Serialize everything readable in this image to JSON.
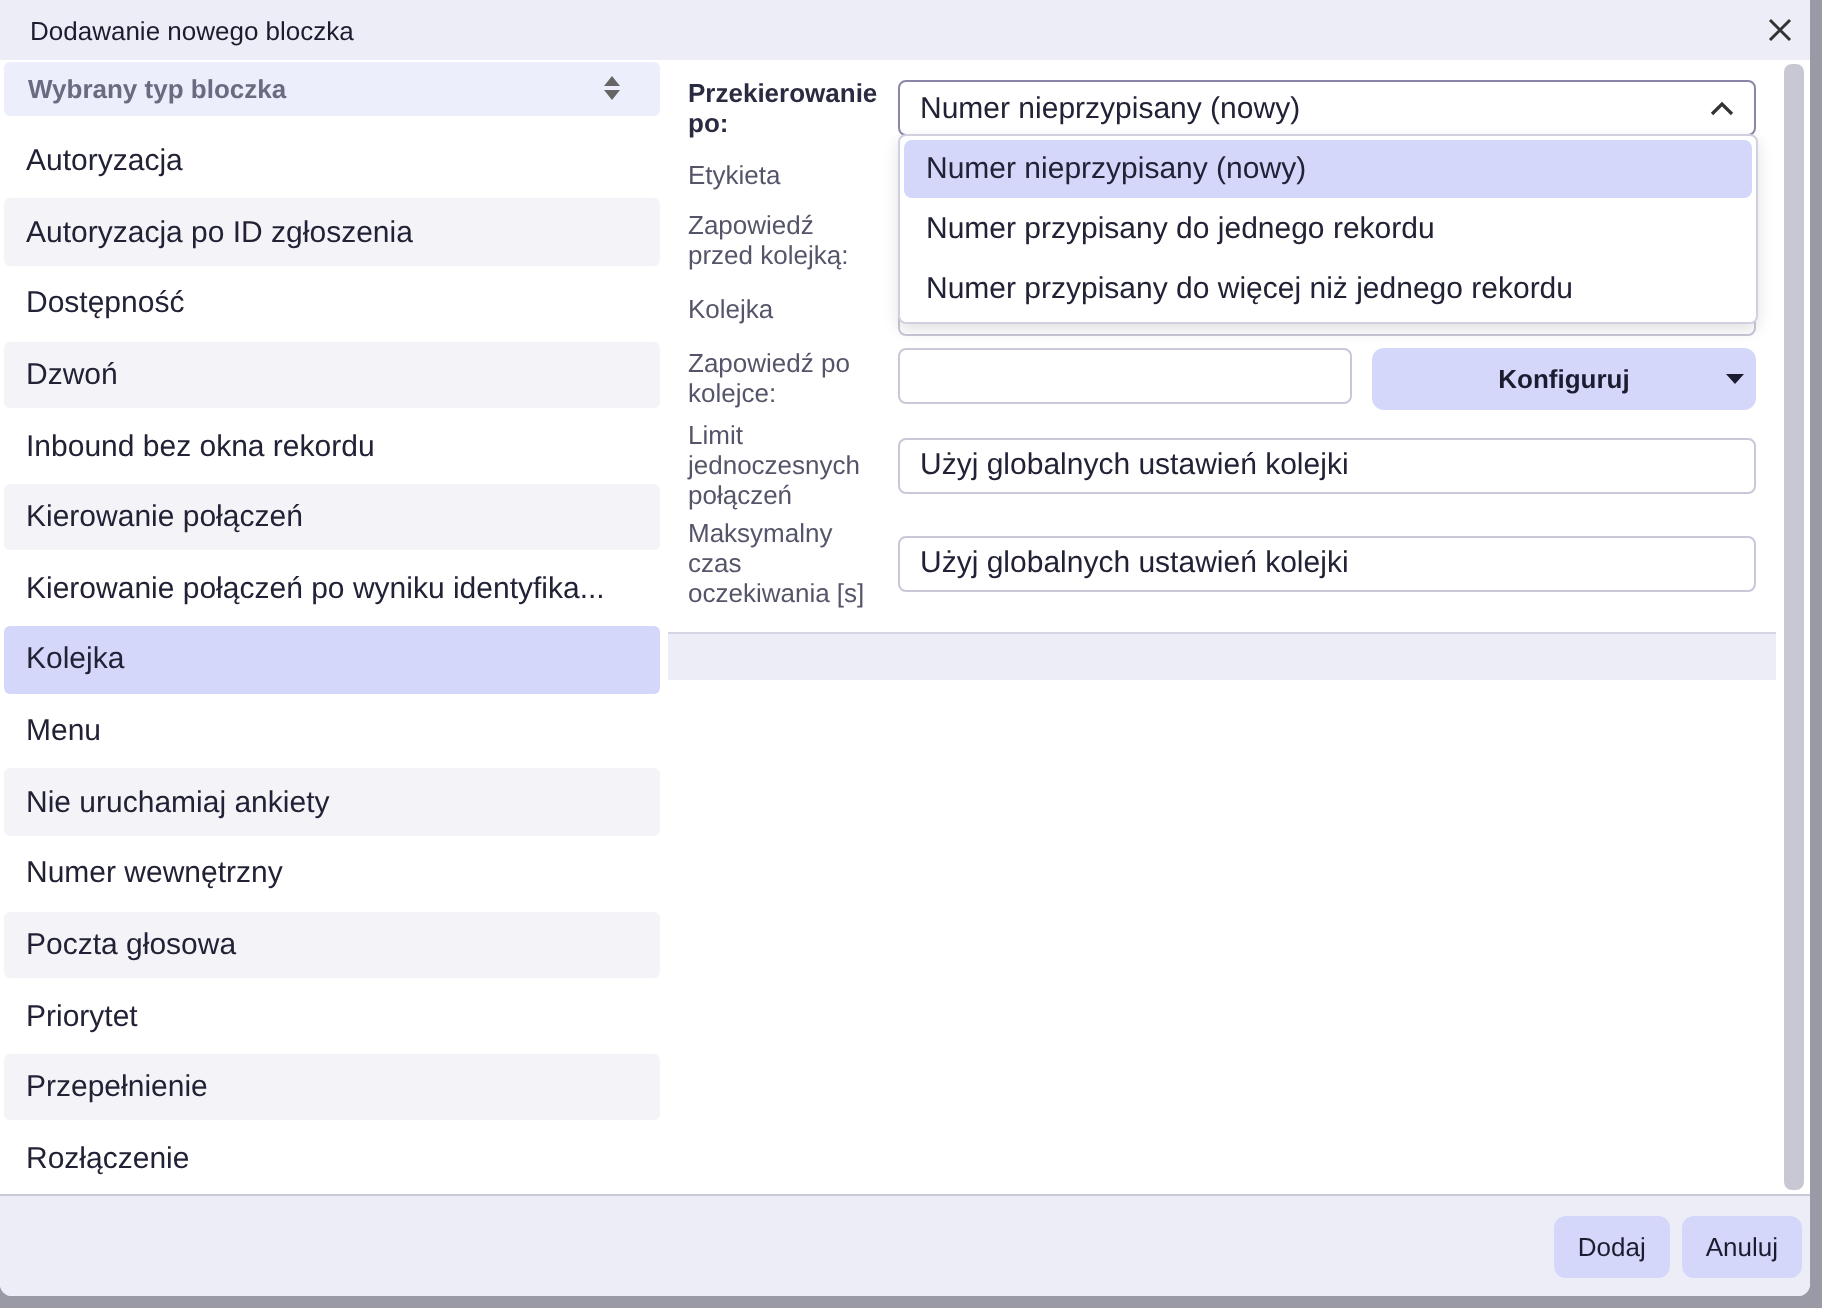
{
  "window": {
    "title": "Dodawanie nowego bloczka"
  },
  "sidebar": {
    "header": "Wybrany typ bloczka",
    "items": [
      {
        "label": "Autoryzacja",
        "selected": false
      },
      {
        "label": "Autoryzacja po ID zgłoszenia",
        "selected": false
      },
      {
        "label": "Dostępność",
        "selected": false
      },
      {
        "label": "Dzwoń",
        "selected": false
      },
      {
        "label": "Inbound bez okna rekordu",
        "selected": false
      },
      {
        "label": "Kierowanie połączeń",
        "selected": false
      },
      {
        "label": "Kierowanie połączeń po wyniku identyfika...",
        "selected": false
      },
      {
        "label": "Kolejka",
        "selected": true
      },
      {
        "label": "Menu",
        "selected": false
      },
      {
        "label": "Nie uruchamiaj ankiety",
        "selected": false
      },
      {
        "label": "Numer wewnętrzny",
        "selected": false
      },
      {
        "label": "Poczta głosowa",
        "selected": false
      },
      {
        "label": "Priorytet",
        "selected": false
      },
      {
        "label": "Przepełnienie",
        "selected": false
      },
      {
        "label": "Rozłączenie",
        "selected": false
      }
    ]
  },
  "form": {
    "fields": [
      {
        "label": "Przekierowanie po:",
        "kind": "select",
        "value": "Numer nieprzypisany (nowy)",
        "expanded": true,
        "options": [
          {
            "label": "Numer nieprzypisany (nowy)",
            "selected": true
          },
          {
            "label": "Numer przypisany do jednego rekordu",
            "selected": false
          },
          {
            "label": "Numer przypisany do więcej niż jednego rekordu",
            "selected": false
          }
        ]
      },
      {
        "label": "Etykieta",
        "kind": "hidden"
      },
      {
        "label": "Zapowiedź przed kolejką:",
        "kind": "hidden"
      },
      {
        "label": "Kolejka",
        "kind": "text"
      },
      {
        "label": "Zapowiedź po kolejce:",
        "kind": "text_button",
        "button": "Konfiguruj"
      },
      {
        "label": "Limit jednoczesnych połączeń",
        "kind": "text",
        "value": "Użyj globalnych ustawień kolejki"
      },
      {
        "label": "Maksymalny czas oczekiwania [s]",
        "kind": "text",
        "value": "Użyj globalnych ustawień kolejki"
      }
    ]
  },
  "buttons": [
    {
      "label": "Dodaj"
    },
    {
      "label": "Anuluj"
    }
  ]
}
